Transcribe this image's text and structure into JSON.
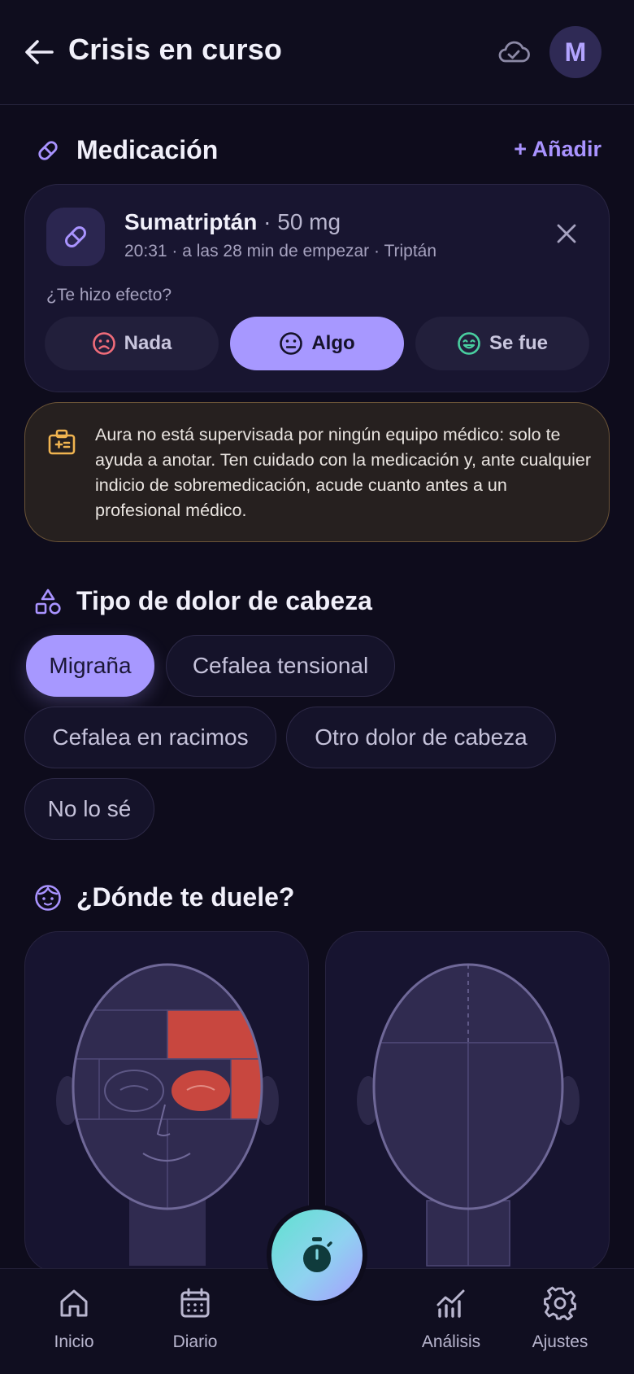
{
  "header": {
    "title": "Crisis en curso",
    "avatar_initial": "M",
    "back_icon": "arrow-left-icon",
    "cloud_icon": "cloud-check-icon"
  },
  "medication": {
    "section_title": "Medicación",
    "add_label": "+ Añadir",
    "item": {
      "name": "Sumatriptán",
      "dose": "· 50 mg",
      "meta": "20:31 · a las 28 min de empezar · Triptán"
    },
    "effect_question": "¿Te hizo efecto?",
    "effect_options": [
      "Nada",
      "Algo",
      "Se fue"
    ],
    "effect_selected": "Algo"
  },
  "warning": {
    "text": "Aura no está supervisada por ningún equipo médico: solo te ayuda a anotar. Ten cuidado con la medicación y, ante cualquier indicio de sobremedicación, acude cuanto antes a un profesional médico."
  },
  "headache_type": {
    "section_title": "Tipo de dolor de cabeza",
    "options": [
      "Migraña",
      "Cefalea tensional",
      "Cefalea en racimos",
      "Otro dolor de cabeza",
      "No lo sé"
    ],
    "selected": "Migraña"
  },
  "pain_location": {
    "section_title": "¿Dónde te duele?",
    "highlight_color": "#c8473f"
  },
  "nav": {
    "items": [
      "Inicio",
      "Diario",
      "Análisis",
      "Ajustes"
    ]
  },
  "colors": {
    "accent": "#a798ff",
    "background": "#0e0c1c",
    "warning_icon": "#f0b450"
  }
}
